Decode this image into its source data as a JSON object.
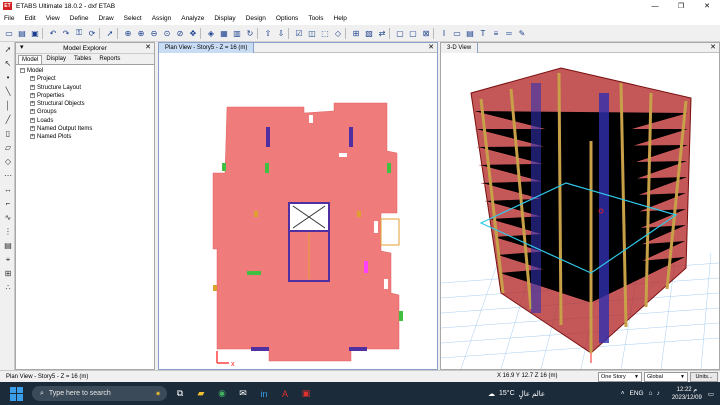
{
  "window": {
    "app_icon_text": "ET",
    "title": "ETABS Ultimate 18.0.2 - dxf ETAB",
    "minimize": "—",
    "maximize": "❐",
    "close": "✕"
  },
  "menu": [
    "File",
    "Edit",
    "View",
    "Define",
    "Draw",
    "Select",
    "Assign",
    "Analyze",
    "Display",
    "Design",
    "Options",
    "Tools",
    "Help"
  ],
  "toolbar_icons": [
    "new-icon",
    "open-icon",
    "save-icon",
    "undo-icon",
    "redo-icon",
    "lock-icon",
    "refresh-icon",
    "pointer-icon",
    "zoom-rubber-icon",
    "zoom-in-icon",
    "zoom-out-icon",
    "zoom-fit-icon",
    "zoom-prev-icon",
    "pan-icon",
    "3d-icon",
    "plan-icon",
    "elevation-icon",
    "rotate-icon",
    "up-icon",
    "down-icon",
    "check-icon",
    "object-shrink-icon",
    "extrude-icon",
    "set-display-icon",
    "grid-icon",
    "assign-icon",
    "move-icon",
    "text-icon",
    "frame-icon",
    "area-icon",
    "font-icon",
    "line-style-icon",
    "color-icon"
  ],
  "explorer": {
    "title": "Model Explorer",
    "tabs": [
      "Model",
      "Display",
      "Tables",
      "Reports"
    ],
    "root": "Model",
    "children": [
      "Project",
      "Structure Layout",
      "Properties",
      "Structural Objects",
      "Groups",
      "Loads",
      "Named Output Items",
      "Named Plots"
    ]
  },
  "plan_view": {
    "tab_label": "Plan View - Story5 - Z = 16 (m)",
    "close": "✕"
  },
  "view3d": {
    "tab_label": "3-D View",
    "close": "✕"
  },
  "status": {
    "message": "Plan View - Story5 - Z = 16 (m)",
    "coords": "X 16.9  Y 12.7  Z 16 (m)",
    "story_option": "One Story",
    "coord_system": "Global",
    "units_button": "Units..."
  },
  "taskbar": {
    "search_placeholder": "Type here to search",
    "weather": "15°C",
    "weather_text": "عالم عالٍ",
    "language": "ENG",
    "time": "12:22 م",
    "date": "2023/12/09"
  },
  "colors": {
    "slab": "#f07b7b",
    "column_purple": "#5030a0",
    "wall_green": "#40c040",
    "beam_orange": "#e0a030",
    "accent": "#3a9ee8"
  }
}
